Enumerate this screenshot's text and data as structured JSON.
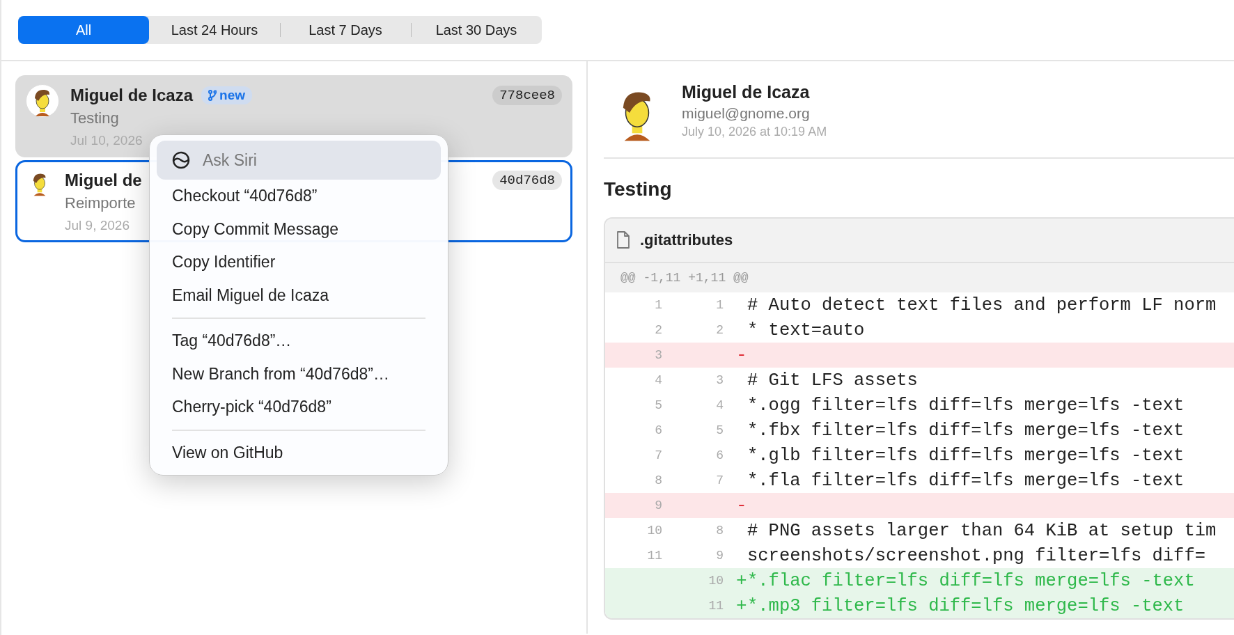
{
  "filter_tabs": [
    {
      "label": "All",
      "selected": true
    },
    {
      "label": "Last 24 Hours",
      "selected": false
    },
    {
      "label": "Last 7 Days",
      "selected": false
    },
    {
      "label": "Last 30 Days",
      "selected": false
    }
  ],
  "commits": [
    {
      "author": "Miguel de Icaza",
      "branch": "new",
      "message": "Testing",
      "date": "Jul 10, 2026",
      "hash": "778cee8",
      "selected": true,
      "focused": false
    },
    {
      "author": "Miguel de",
      "message": "Reimporte",
      "date": "Jul 9, 2026",
      "hash": "40d76d8",
      "selected": false,
      "focused": true
    }
  ],
  "context_menu": {
    "groups": [
      [
        {
          "kind": "siri",
          "label": "Ask Siri",
          "selected": true
        },
        {
          "kind": "command",
          "label": "Checkout “40d76d8”",
          "selected": false
        },
        {
          "kind": "command",
          "label": "Copy Commit Message",
          "selected": false
        },
        {
          "kind": "command",
          "label": "Copy Identifier",
          "selected": false
        },
        {
          "kind": "command",
          "label": "Email Miguel de Icaza",
          "selected": false
        }
      ],
      [
        {
          "kind": "command",
          "label": "Tag “40d76d8”…",
          "selected": false
        },
        {
          "kind": "command",
          "label": "New Branch from “40d76d8”…",
          "selected": false
        },
        {
          "kind": "command",
          "label": "Cherry-pick “40d76d8”",
          "selected": false
        }
      ],
      [
        {
          "kind": "command",
          "label": "View on GitHub",
          "selected": false
        }
      ]
    ]
  },
  "detail": {
    "author": "Miguel de Icaza",
    "email": "miguel@gnome.org",
    "date": "July 10, 2026 at 10:19 AM",
    "title": "Testing",
    "file": {
      "name": ".gitattributes",
      "hunk": "@@ -1,11 +1,11 @@",
      "lines": [
        {
          "kind": "context",
          "old": "1",
          "new": "1",
          "text": "# Auto detect text files and perform LF norm"
        },
        {
          "kind": "context",
          "old": "2",
          "new": "2",
          "text": "* text=auto"
        },
        {
          "kind": "removed",
          "old": "3",
          "prefix": "-"
        },
        {
          "kind": "context",
          "old": "4",
          "new": "3",
          "text": "# Git LFS assets"
        },
        {
          "kind": "context",
          "old": "5",
          "new": "4",
          "text": "*.ogg filter=lfs diff=lfs merge=lfs -text"
        },
        {
          "kind": "context",
          "old": "6",
          "new": "5",
          "text": "*.fbx filter=lfs diff=lfs merge=lfs -text"
        },
        {
          "kind": "context",
          "old": "7",
          "new": "6",
          "text": "*.glb filter=lfs diff=lfs merge=lfs -text"
        },
        {
          "kind": "context",
          "old": "8",
          "new": "7",
          "text": "*.fla filter=lfs diff=lfs merge=lfs -text"
        },
        {
          "kind": "removed",
          "old": "9",
          "prefix": "-"
        },
        {
          "kind": "context",
          "old": "10",
          "new": "8",
          "text": "# PNG assets larger than 64 KiB at setup tim"
        },
        {
          "kind": "context",
          "old": "11",
          "new": "9",
          "text": "screenshots/screenshot.png filter=lfs diff="
        },
        {
          "kind": "added",
          "new": "10",
          "prefix": "+",
          "text": "*.flac filter=lfs diff=lfs merge=lfs -text"
        },
        {
          "kind": "added",
          "new": "11",
          "prefix": "+",
          "text": "*.mp3 filter=lfs diff=lfs merge=lfs -text"
        }
      ]
    }
  }
}
